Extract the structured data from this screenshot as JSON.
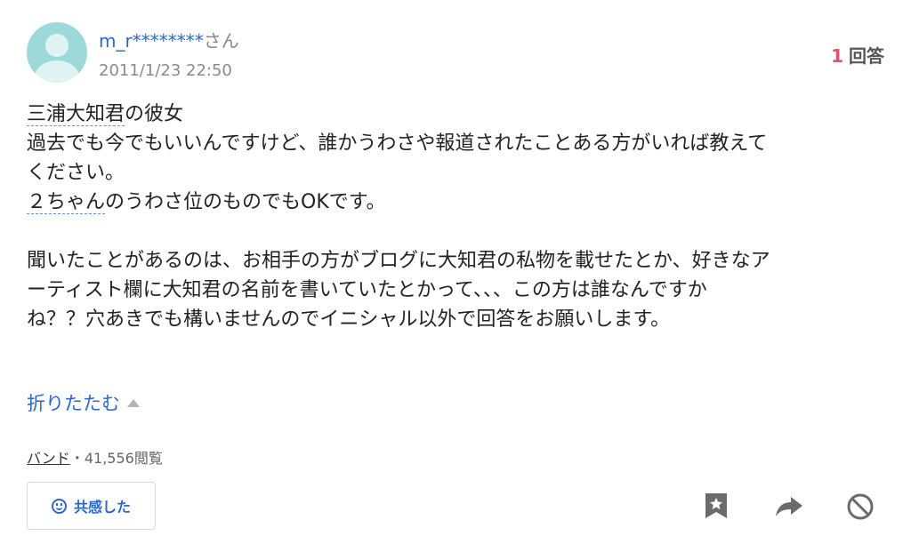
{
  "user": {
    "name": "m_r********",
    "name_suffix": "さん",
    "date": "2011/1/23 22:50"
  },
  "answers": {
    "count": "1",
    "label": "回答"
  },
  "question": {
    "keyword1": "三浦大知君",
    "line1_rest": "の彼女",
    "line2": "過去でも今でもいいんですけど、誰かうわさや報道されたことある方がいれば教えて",
    "line3": "ください。",
    "keyword2": "２ちゃん",
    "line4_rest": "のうわさ位のものでもOKです。",
    "line5": "聞いたことがあるのは、お相手の方がブログに大知君の私物を載せたとか、好きなア",
    "line6": "ーティスト欄に大知君の名前を書いていたとかって、、、この方は誰なんですか",
    "line7": "ね？？穴あきでも構いませんのでイニシャル以外で回答をお願いします。"
  },
  "collapse_label": "折りたたむ",
  "meta": {
    "category": "バンド",
    "separator": "・",
    "views": "41,556閲覧"
  },
  "empathy_button": {
    "label": "共感した",
    "icon": "smile-icon"
  },
  "actions": {
    "icons": [
      "bookmark-star-icon",
      "share-arrow-icon",
      "block-icon"
    ]
  },
  "colors": {
    "link": "#2c67c9",
    "count": "#e2506b",
    "avatar": "#9ed9d9"
  }
}
